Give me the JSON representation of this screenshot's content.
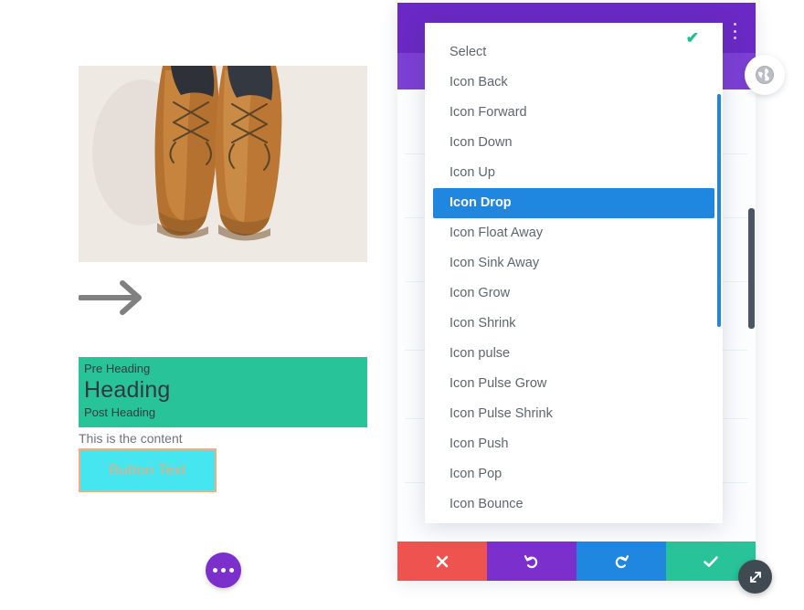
{
  "canvas": {
    "photo_alt": "brown-leather-boots-photo",
    "arrow_icon": "arrow-right-icon",
    "pre_heading": "Pre Heading",
    "heading": "Heading",
    "post_heading": "Post Heading",
    "content": "This is the content",
    "button_text": "Button Text",
    "fab_icon": "ellipsis-icon",
    "colors": {
      "heading_bg": "#29c39a",
      "button_bg": "#45e6f0",
      "button_border": "#f6ac7c",
      "button_text": "#f3a878",
      "fab_bg": "#7b2fcc"
    }
  },
  "modal": {
    "kebab_icon": "more-vertical-icon",
    "globe_icon": "globe-icon",
    "colors": {
      "topbar": "#6a29c4",
      "subbar": "#7c3fd4"
    }
  },
  "dropdown": {
    "selected_value": "Select",
    "highlighted_value": "Icon Drop",
    "check_icon": "check-icon",
    "highlight_color": "#2087e0",
    "check_color": "#1ec18f",
    "items": [
      {
        "label": "Select",
        "selected": true,
        "active": false
      },
      {
        "label": "Icon Back",
        "selected": false,
        "active": false
      },
      {
        "label": "Icon Forward",
        "selected": false,
        "active": false
      },
      {
        "label": "Icon Down",
        "selected": false,
        "active": false
      },
      {
        "label": "Icon Up",
        "selected": false,
        "active": false
      },
      {
        "label": "Icon Drop",
        "selected": false,
        "active": true
      },
      {
        "label": "Icon Float Away",
        "selected": false,
        "active": false
      },
      {
        "label": "Icon Sink Away",
        "selected": false,
        "active": false
      },
      {
        "label": "Icon Grow",
        "selected": false,
        "active": false
      },
      {
        "label": "Icon Shrink",
        "selected": false,
        "active": false
      },
      {
        "label": "Icon pulse",
        "selected": false,
        "active": false
      },
      {
        "label": "Icon Pulse Grow",
        "selected": false,
        "active": false
      },
      {
        "label": "Icon Pulse Shrink",
        "selected": false,
        "active": false
      },
      {
        "label": "Icon Push",
        "selected": false,
        "active": false
      },
      {
        "label": "Icon Pop",
        "selected": false,
        "active": false
      },
      {
        "label": "Icon Bounce",
        "selected": false,
        "active": false
      }
    ]
  },
  "action_bar": {
    "buttons": [
      {
        "name": "close-button",
        "icon": "close-icon",
        "color": "#ef5350"
      },
      {
        "name": "undo-button",
        "icon": "undo-icon",
        "color": "#7b2fcc"
      },
      {
        "name": "redo-button",
        "icon": "redo-icon",
        "color": "#2087e0"
      },
      {
        "name": "save-button",
        "icon": "check-icon",
        "color": "#29c39a"
      }
    ],
    "resize_icon": "resize-handle-icon"
  },
  "scrollbars": {
    "dropdown_color": "#2087e0",
    "panel_color": "#4b5563"
  }
}
